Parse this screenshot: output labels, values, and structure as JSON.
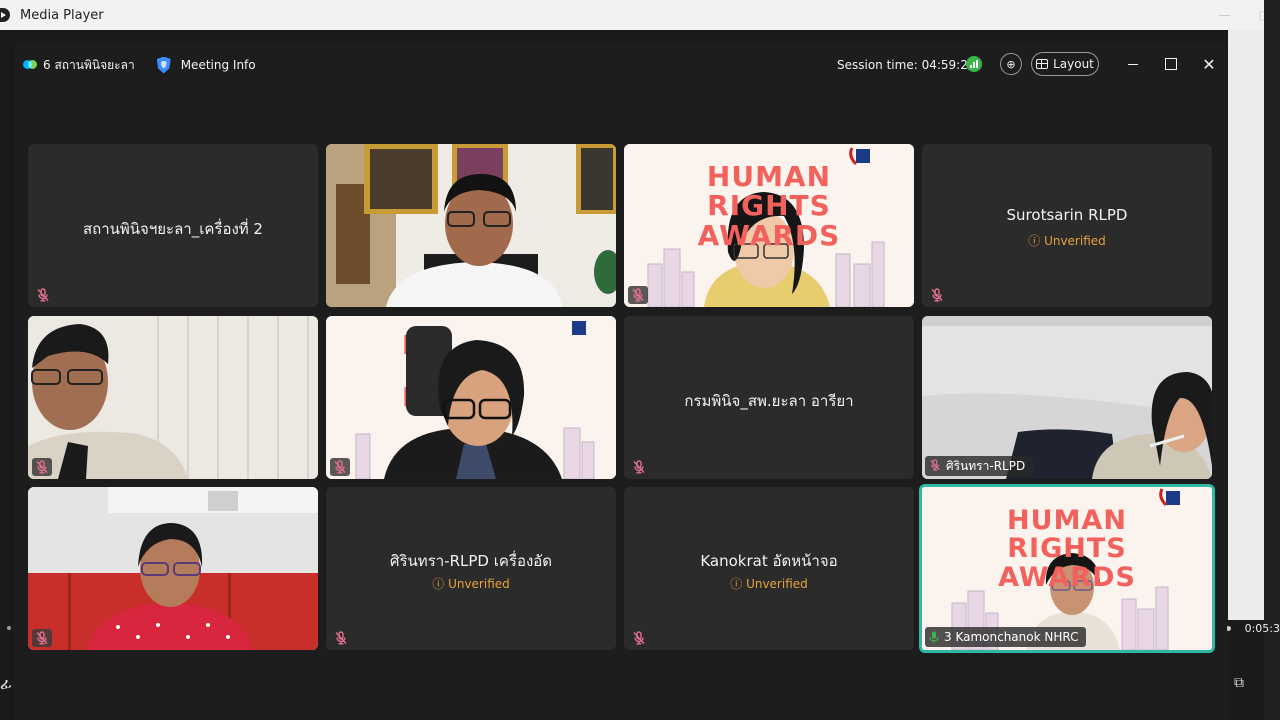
{
  "media_player": {
    "title": "Media Player",
    "time": "0:05:3"
  },
  "meeting": {
    "brand_label": "6 สถานพินิจยะลา",
    "info_label": "Meeting Info",
    "session_time": "Session time: 04:59:26",
    "layout_label": "Layout",
    "close_glyph": "✕"
  },
  "tiles": [
    {
      "name": "สถานพินิจฯยะลา_เครื่องที่ 2",
      "kind": "avatar"
    },
    {
      "name": "",
      "kind": "video-office"
    },
    {
      "name": "",
      "kind": "video-poster-girl",
      "poster_title": "HUMAN RIGHTS AWARDS"
    },
    {
      "name": "Surotsarin RLPD",
      "kind": "avatar",
      "status": "Unverified"
    },
    {
      "name": "",
      "kind": "video-man"
    },
    {
      "name": "",
      "kind": "video-poster-woman"
    },
    {
      "name": "กรมพินิจ_สพ.ยะลา อารียา",
      "kind": "avatar"
    },
    {
      "name": "ศิรินทรา-RLPD",
      "kind": "video-meeting-room"
    },
    {
      "name": "",
      "kind": "video-woman-red"
    },
    {
      "name": "ศิรินทรา-RLPD เครื่องอัด",
      "kind": "avatar",
      "status": "Unverified"
    },
    {
      "name": "Kanokrat อัดหน้าจอ",
      "kind": "avatar",
      "status": "Unverified"
    },
    {
      "name": "3 Kamonchanok NHRC",
      "kind": "video-poster-active",
      "poster_title": "HUMAN RIGHTS AWARDS"
    }
  ],
  "colors": {
    "unverified": "#e6a23c",
    "active_border": "#2fb8a3",
    "poster_red": "#f2615b",
    "signal_green": "#3bb54a"
  },
  "icons": [
    "media-player-icon",
    "webex-logo-icon",
    "shield-icon",
    "signal-icon",
    "zoom-icon",
    "layout-icon",
    "minimize-icon",
    "maximize-icon",
    "close-icon",
    "mic-muted-icon",
    "mic-active-icon",
    "warning-circle-icon"
  ]
}
